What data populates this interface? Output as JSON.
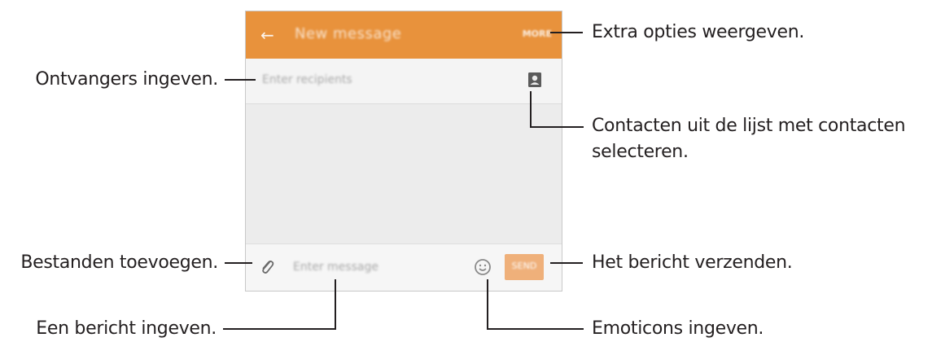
{
  "phone": {
    "appbar": {
      "back_icon": "arrow-left-icon",
      "title": "New message",
      "more_label": "MORE"
    },
    "recipient": {
      "placeholder": "Enter recipients",
      "contact_icon": "contact-picker-icon"
    },
    "compose": {
      "attach_icon": "paperclip-icon",
      "placeholder": "Enter message",
      "emoticon_icon": "smiley-icon",
      "send_label": "SEND"
    }
  },
  "callouts": {
    "extra_options": "Extra opties weergeven.",
    "enter_recipients": "Ontvangers ingeven.",
    "contacts_line1": "Contacten uit de lijst met contacten",
    "contacts_line2": "selecteren.",
    "add_files": "Bestanden toevoegen.",
    "send_message": "Het bericht verzenden.",
    "enter_message": "Een bericht ingeven.",
    "enter_emoticons": "Emoticons ingeven."
  },
  "colors": {
    "appbar": "#e8923c",
    "send_button": "#efb07a",
    "screen_background": "#ececec",
    "callout_text": "#231f20"
  }
}
